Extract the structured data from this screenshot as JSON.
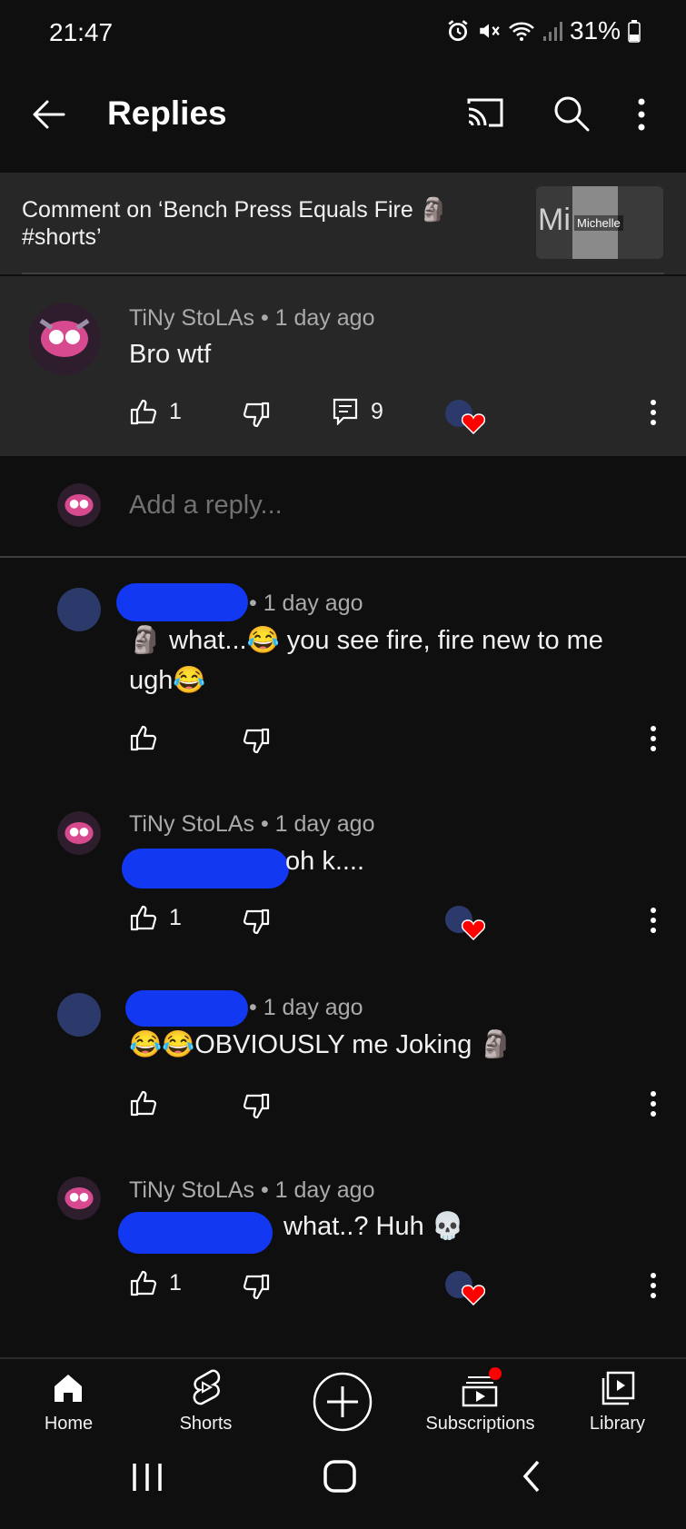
{
  "status_bar": {
    "time": "21:47",
    "battery": "31%"
  },
  "app_bar": {
    "title": "Replies"
  },
  "context": {
    "text": "Comment on ‘Bench Press Equals Fire 🗿 #shorts’",
    "thumb_label": "Michelle",
    "thumb_big": "Mi"
  },
  "parent_comment": {
    "author": "TiNy StoLAs",
    "time": "• 1 day ago",
    "text": "Bro wtf",
    "likes": "1",
    "replies": "9"
  },
  "reply_box": {
    "placeholder": "Add a reply..."
  },
  "replies": [
    {
      "time": "• 1 day ago",
      "text_line1": "🗿 what...😂 you see fire, fire new to me",
      "text_line2": "ugh😂",
      "likes": ""
    },
    {
      "author": "TiNy StoLAs",
      "time": "• 1 day ago",
      "text": "oh k....",
      "likes": "1"
    },
    {
      "time": "• 1 day ago",
      "text": "😂😂OBVIOUSLY me Joking 🗿",
      "likes": ""
    },
    {
      "author": "TiNy StoLAs",
      "time": "• 1 day ago",
      "text": "what..? Huh 💀",
      "likes": "1"
    }
  ],
  "bottom_nav": {
    "items": [
      {
        "label": "Home"
      },
      {
        "label": "Shorts"
      },
      {
        "label": ""
      },
      {
        "label": "Subscriptions"
      },
      {
        "label": "Library"
      }
    ]
  },
  "colors": {
    "background": "#0f0f0f",
    "surface": "#272727",
    "heart": "#ff0000",
    "redaction": "#1238f2"
  },
  "icons": [
    "back-arrow-icon",
    "cast-icon",
    "search-icon",
    "more-vert-icon",
    "thumb-up-icon",
    "thumb-down-icon",
    "reply-comment-icon",
    "heart-icon",
    "home-icon",
    "shorts-icon",
    "create-icon",
    "subscriptions-icon",
    "library-icon"
  ]
}
